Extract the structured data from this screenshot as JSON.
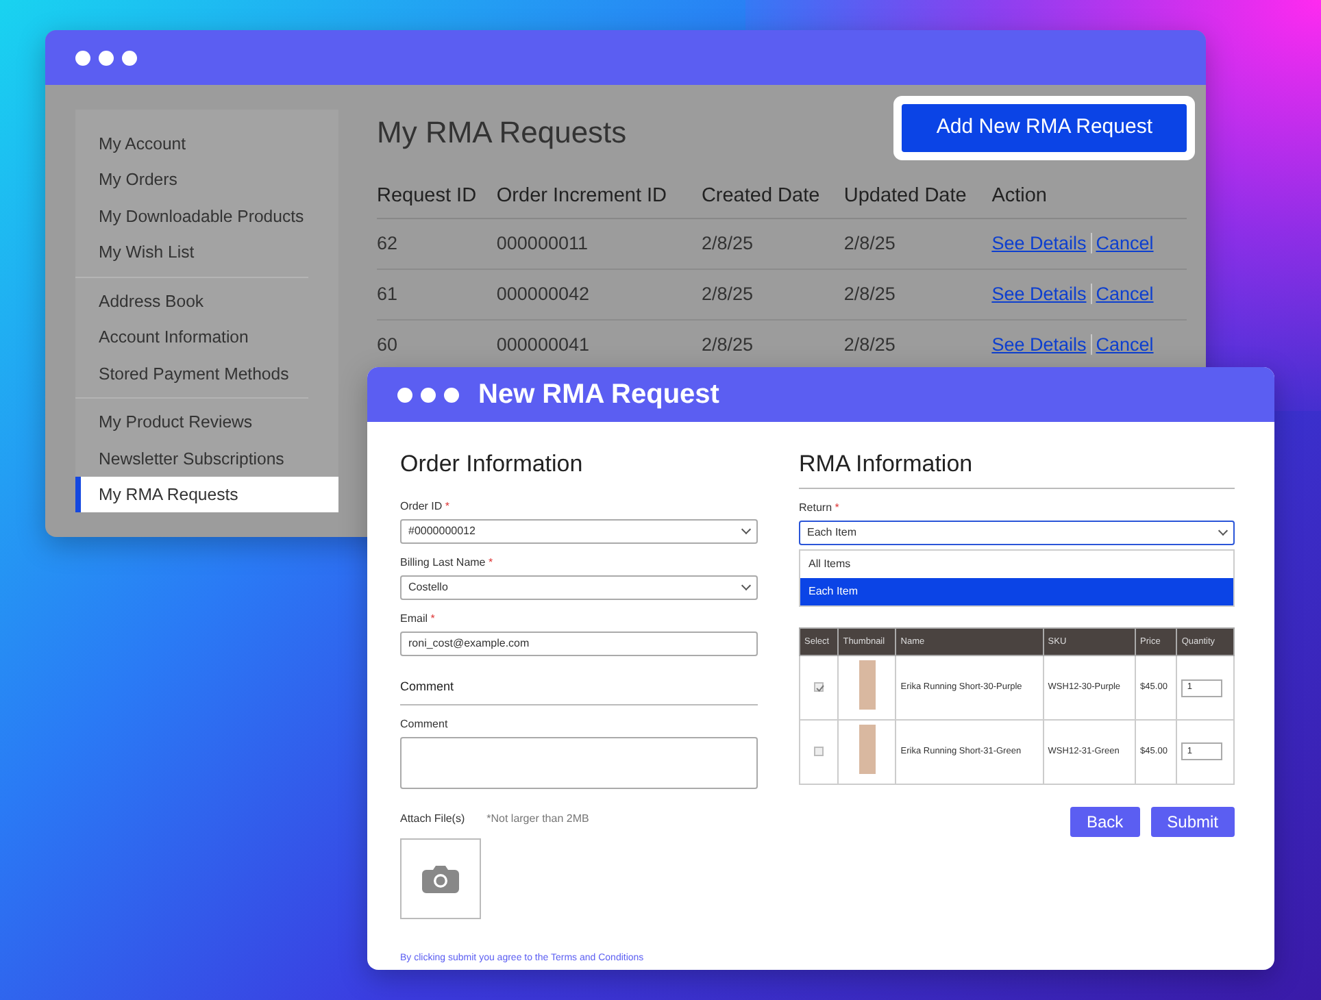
{
  "back_window": {
    "sidebar": {
      "groups": [
        {
          "items": [
            {
              "label": "My Account",
              "selected": false
            },
            {
              "label": "My Orders",
              "selected": false
            },
            {
              "label": "My Downloadable Products",
              "selected": false
            },
            {
              "label": "My Wish List",
              "selected": false
            }
          ]
        },
        {
          "items": [
            {
              "label": "Address Book",
              "selected": false
            },
            {
              "label": "Account Information",
              "selected": false
            },
            {
              "label": "Stored Payment Methods",
              "selected": false
            }
          ]
        },
        {
          "items": [
            {
              "label": "My Product Reviews",
              "selected": false
            },
            {
              "label": "Newsletter Subscriptions",
              "selected": false
            },
            {
              "label": "My RMA Requests",
              "selected": true
            }
          ]
        }
      ]
    },
    "title": "My RMA Requests",
    "add_button": "Add New RMA Request",
    "table": {
      "columns": [
        "Request ID",
        "Order Increment ID",
        "Created Date",
        "Updated Date",
        "Action"
      ],
      "rows": [
        {
          "id": "62",
          "order": "000000011",
          "created": "2/8/25",
          "updated": "2/8/25",
          "actions": [
            "See Details",
            "Cancel"
          ]
        },
        {
          "id": "61",
          "order": "000000042",
          "created": "2/8/25",
          "updated": "2/8/25",
          "actions": [
            "See Details",
            "Cancel"
          ]
        },
        {
          "id": "60",
          "order": "000000041",
          "created": "2/8/25",
          "updated": "2/8/25",
          "actions": [
            "See Details",
            "Cancel"
          ]
        }
      ]
    }
  },
  "dialog": {
    "title": "New RMA Request",
    "order_info": {
      "heading": "Order Information",
      "fields": [
        {
          "kind": "select",
          "label": "Order ID",
          "required_mark": "*",
          "value": "#0000000012"
        },
        {
          "kind": "select",
          "label": "Billing Last Name",
          "required_mark": "*",
          "value": "Costello"
        },
        {
          "kind": "text",
          "label": "Email",
          "required_mark": "*",
          "value": "roni_cost@example.com"
        }
      ],
      "comment_heading": "Comment",
      "comment_label": "Comment",
      "attach_label": "Attach File(s)",
      "attach_note": "*Not larger than 2MB",
      "terms": "By clicking submit you agree to the Terms and Conditions"
    },
    "rma_info": {
      "heading": "RMA Information",
      "return_label": "Return",
      "return_required_mark": "*",
      "return_value": "Each Item",
      "return_options": [
        {
          "label": "All Items",
          "selected": false
        },
        {
          "label": "Each Item",
          "selected": true
        }
      ],
      "table": {
        "columns": [
          "Select",
          "Thumbnail",
          "Name",
          "SKU",
          "Price",
          "Quantity"
        ],
        "rows": [
          {
            "checked": true,
            "name": "Erika Running Short-30-Purple",
            "sku": "WSH12-30-Purple",
            "price": "$45.00",
            "quantity": "1"
          },
          {
            "checked": false,
            "name": "Erika Running Short-31-Green",
            "sku": "WSH12-31-Green",
            "price": "$45.00",
            "quantity": "1"
          }
        ]
      },
      "buttons": [
        "Back",
        "Submit"
      ]
    }
  }
}
